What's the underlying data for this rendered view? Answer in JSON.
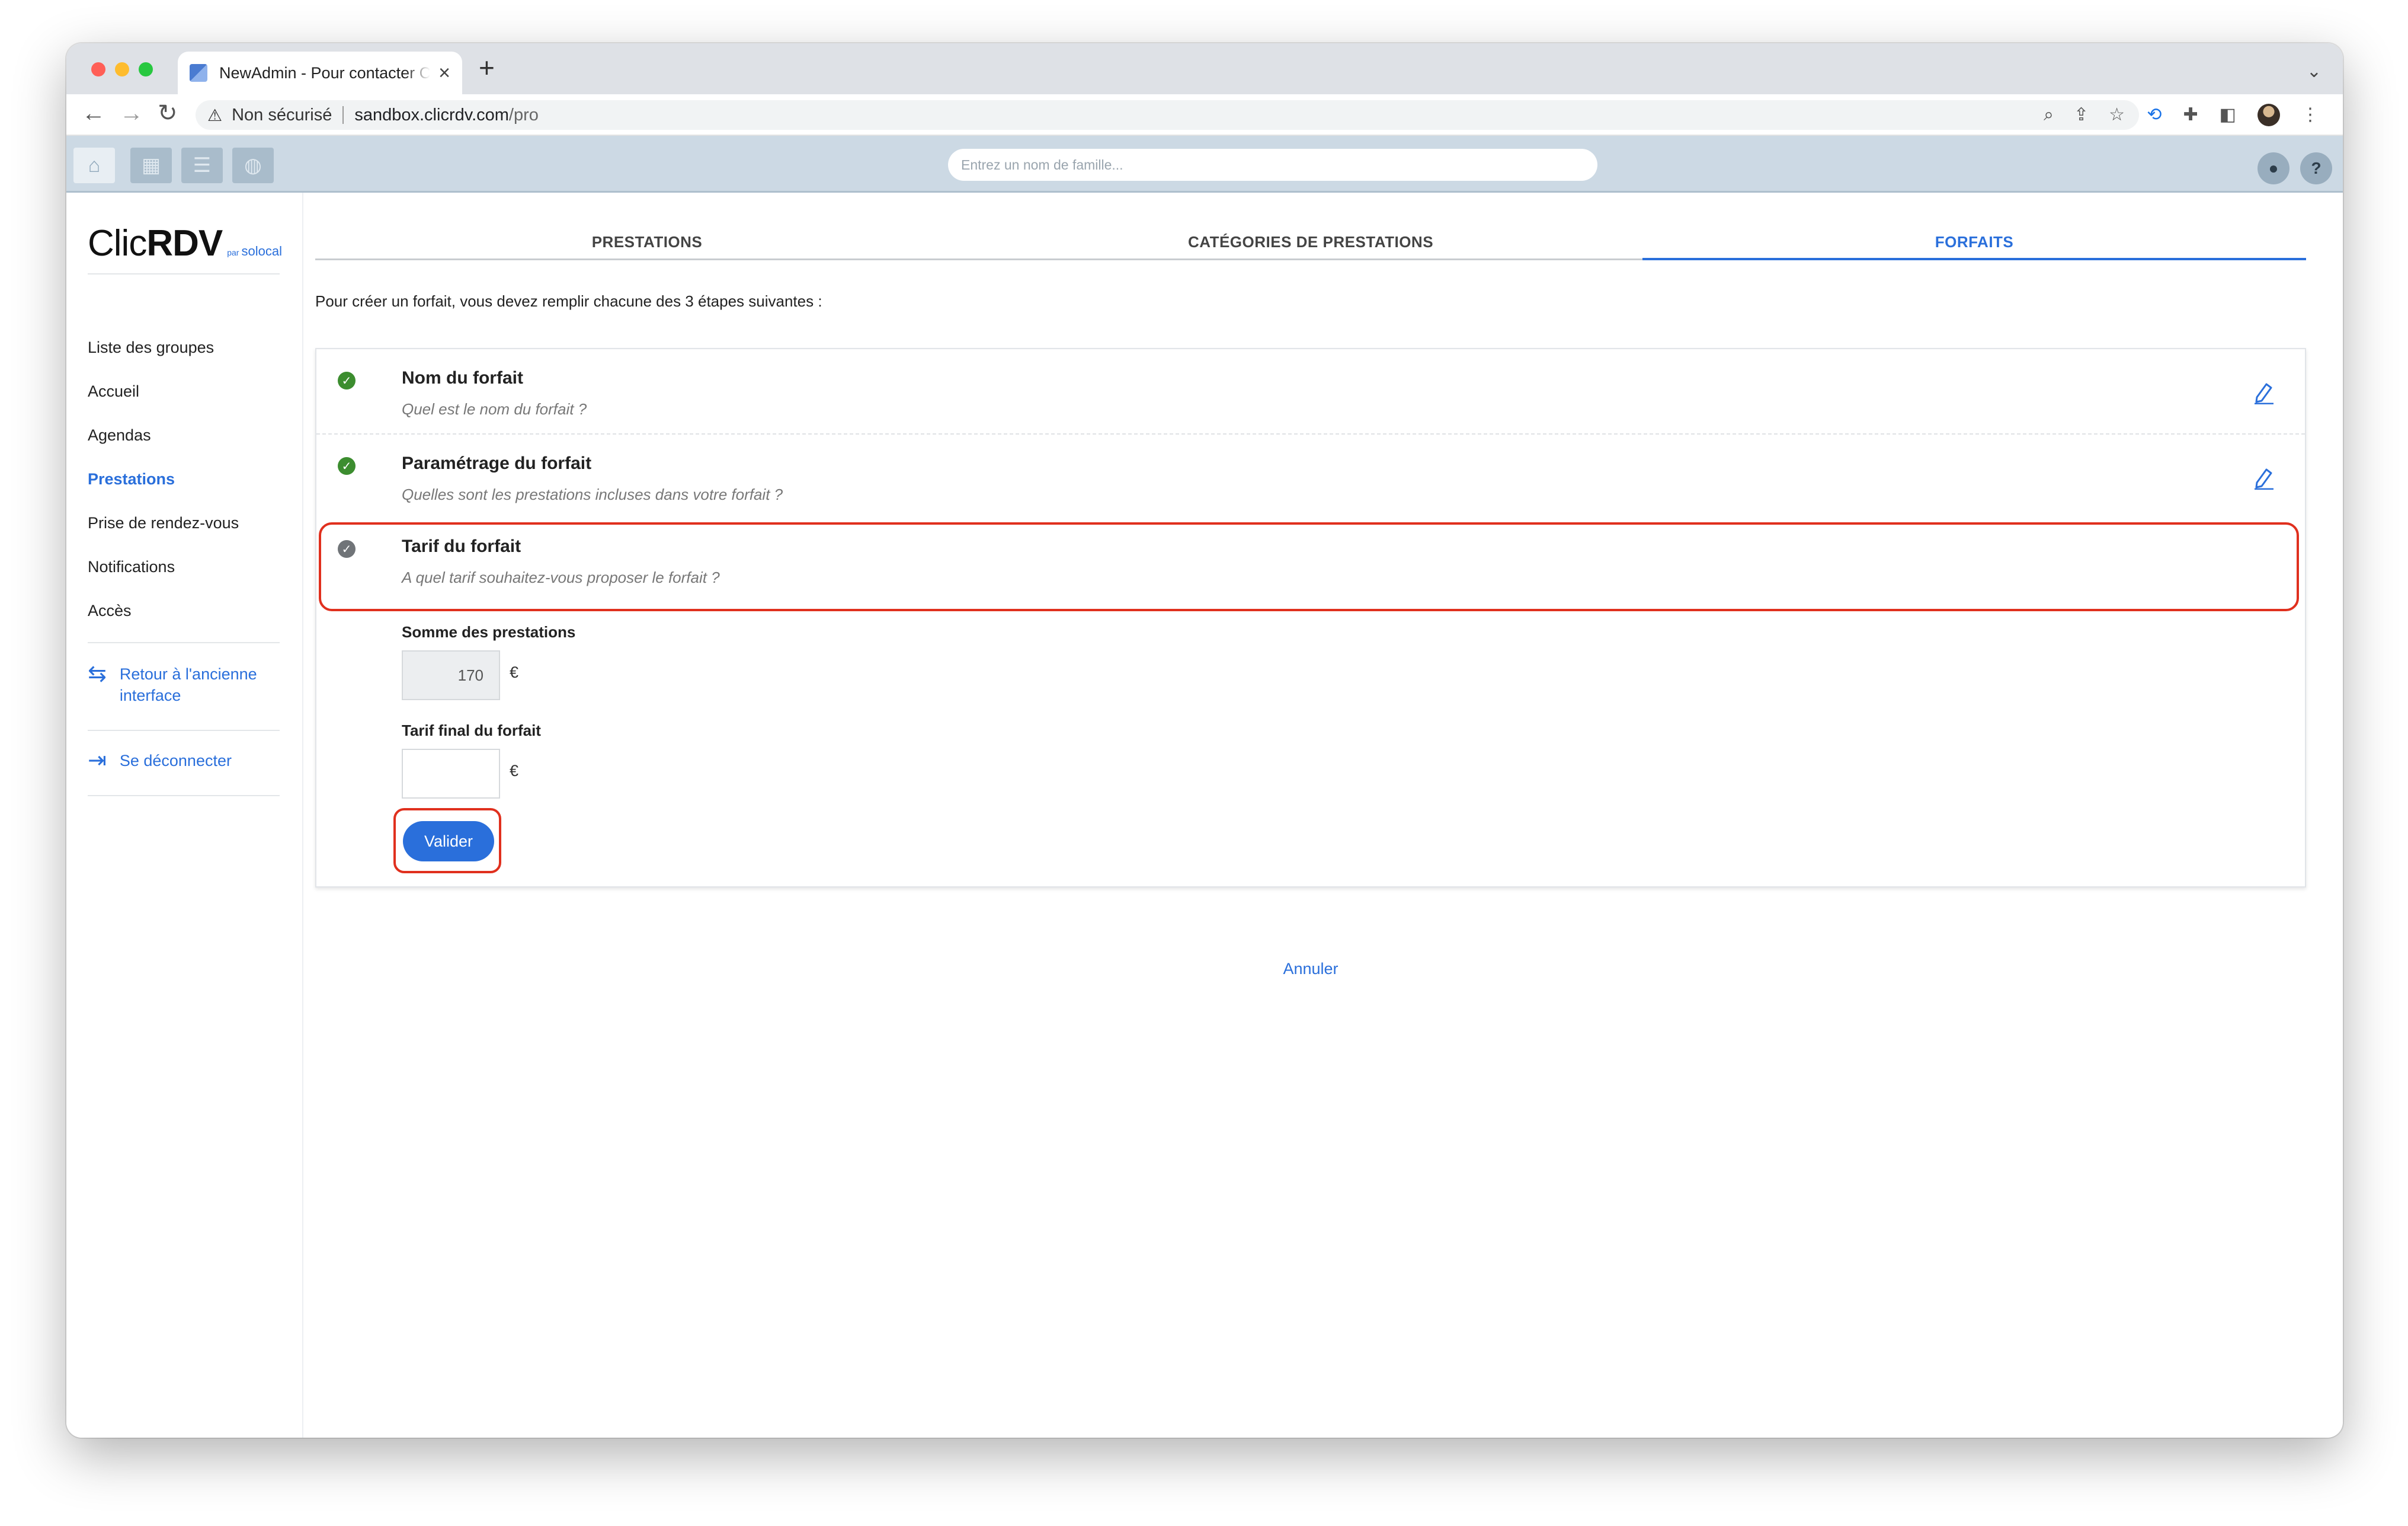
{
  "browser": {
    "tab_title": "NewAdmin - Pour contacter ClicRDV",
    "not_secure": "Non sécurisé",
    "url_host": "sandbox.clicrdv.com",
    "url_path": "/pro"
  },
  "header": {
    "search_placeholder": "Entrez un nom de famille...",
    "help_label": "?"
  },
  "logo": {
    "clic": "Clic",
    "rdv": "RDV",
    "by": "par",
    "solocal": "solocal"
  },
  "sidebar": {
    "items": [
      {
        "label": "Liste des groupes"
      },
      {
        "label": "Accueil"
      },
      {
        "label": "Agendas"
      },
      {
        "label": "Prestations",
        "active": true
      },
      {
        "label": "Prise de rendez-vous"
      },
      {
        "label": "Notifications"
      },
      {
        "label": "Accès"
      }
    ],
    "back_link": "Retour à l'ancienne interface",
    "logout": "Se déconnecter"
  },
  "tabs": [
    {
      "label": "PRESTATIONS"
    },
    {
      "label": "CATÉGORIES DE PRESTATIONS"
    },
    {
      "label": "FORFAITS",
      "active": true
    }
  ],
  "intro": "Pour créer un forfait, vous devez remplir chacune des 3 étapes suivantes :",
  "steps": [
    {
      "title": "Nom du forfait",
      "subtitle": "Quel est le nom du forfait ?",
      "status": "done"
    },
    {
      "title": "Paramétrage du forfait",
      "subtitle": "Quelles sont les prestations incluses dans votre forfait ?",
      "status": "done"
    },
    {
      "title": "Tarif du forfait",
      "subtitle": "A quel tarif souhaitez-vous proposer le forfait ?",
      "status": "pending"
    }
  ],
  "form": {
    "sum_label": "Somme des prestations",
    "sum_value": "170",
    "final_label": "Tarif final du forfait",
    "final_value": "",
    "currency": "€",
    "validate": "Valider"
  },
  "cancel": "Annuler",
  "colors": {
    "accent": "#2a6fdb",
    "done": "#3c8d2f",
    "highlight": "#e0301e"
  }
}
